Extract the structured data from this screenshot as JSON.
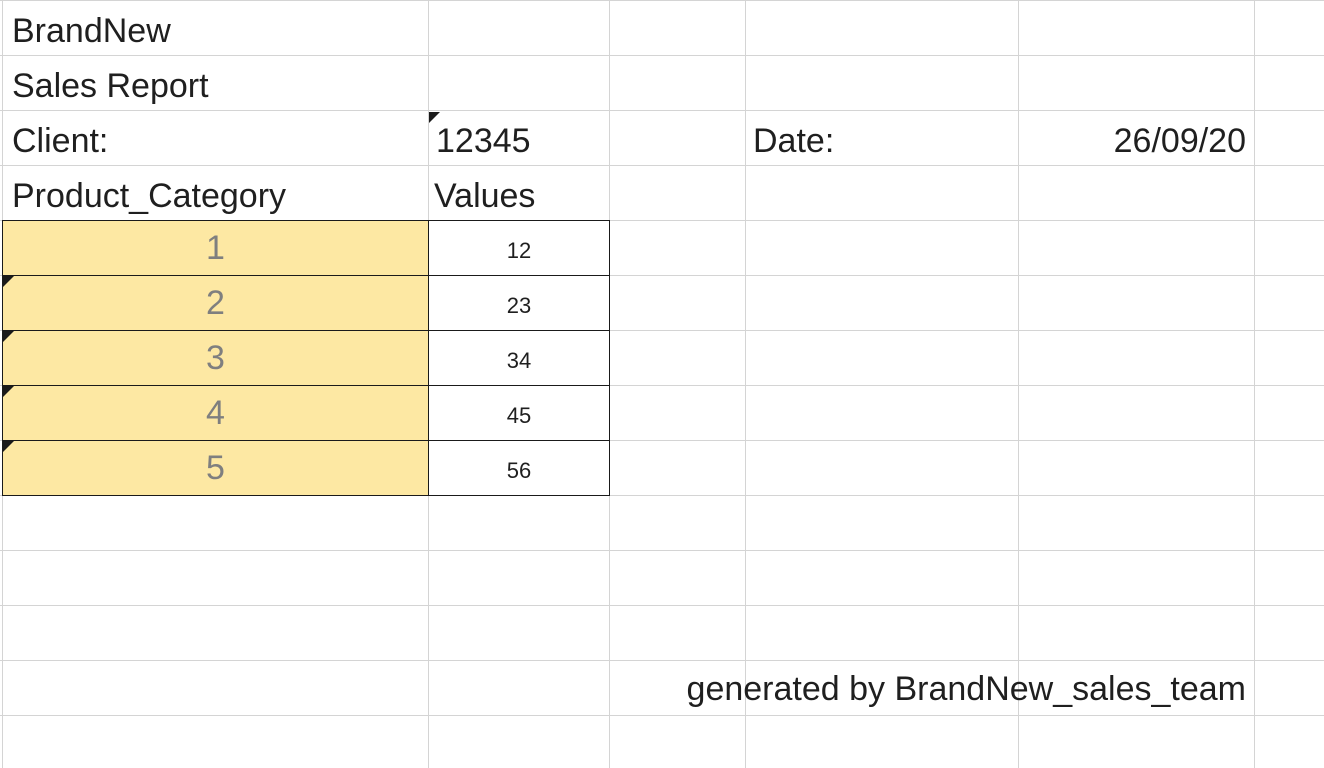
{
  "sheet": {
    "brand": "BrandNew",
    "report_title": "Sales Report",
    "client_label": "Client:",
    "client_value": "12345",
    "date_label": "Date:",
    "date_value": "26/09/20",
    "col_category_header": "Product_Category",
    "col_values_header": "Values",
    "rows": [
      {
        "category": "1",
        "value": "12"
      },
      {
        "category": "2",
        "value": "23"
      },
      {
        "category": "3",
        "value": "34"
      },
      {
        "category": "4",
        "value": "45"
      },
      {
        "category": "5",
        "value": "56"
      }
    ],
    "footer": "generated by BrandNew_sales_team"
  },
  "colors": {
    "category_fill": "#fde8a3",
    "category_text": "#7f7f7f",
    "gridline": "#d4d4d4",
    "border": "#1a1a1a"
  }
}
